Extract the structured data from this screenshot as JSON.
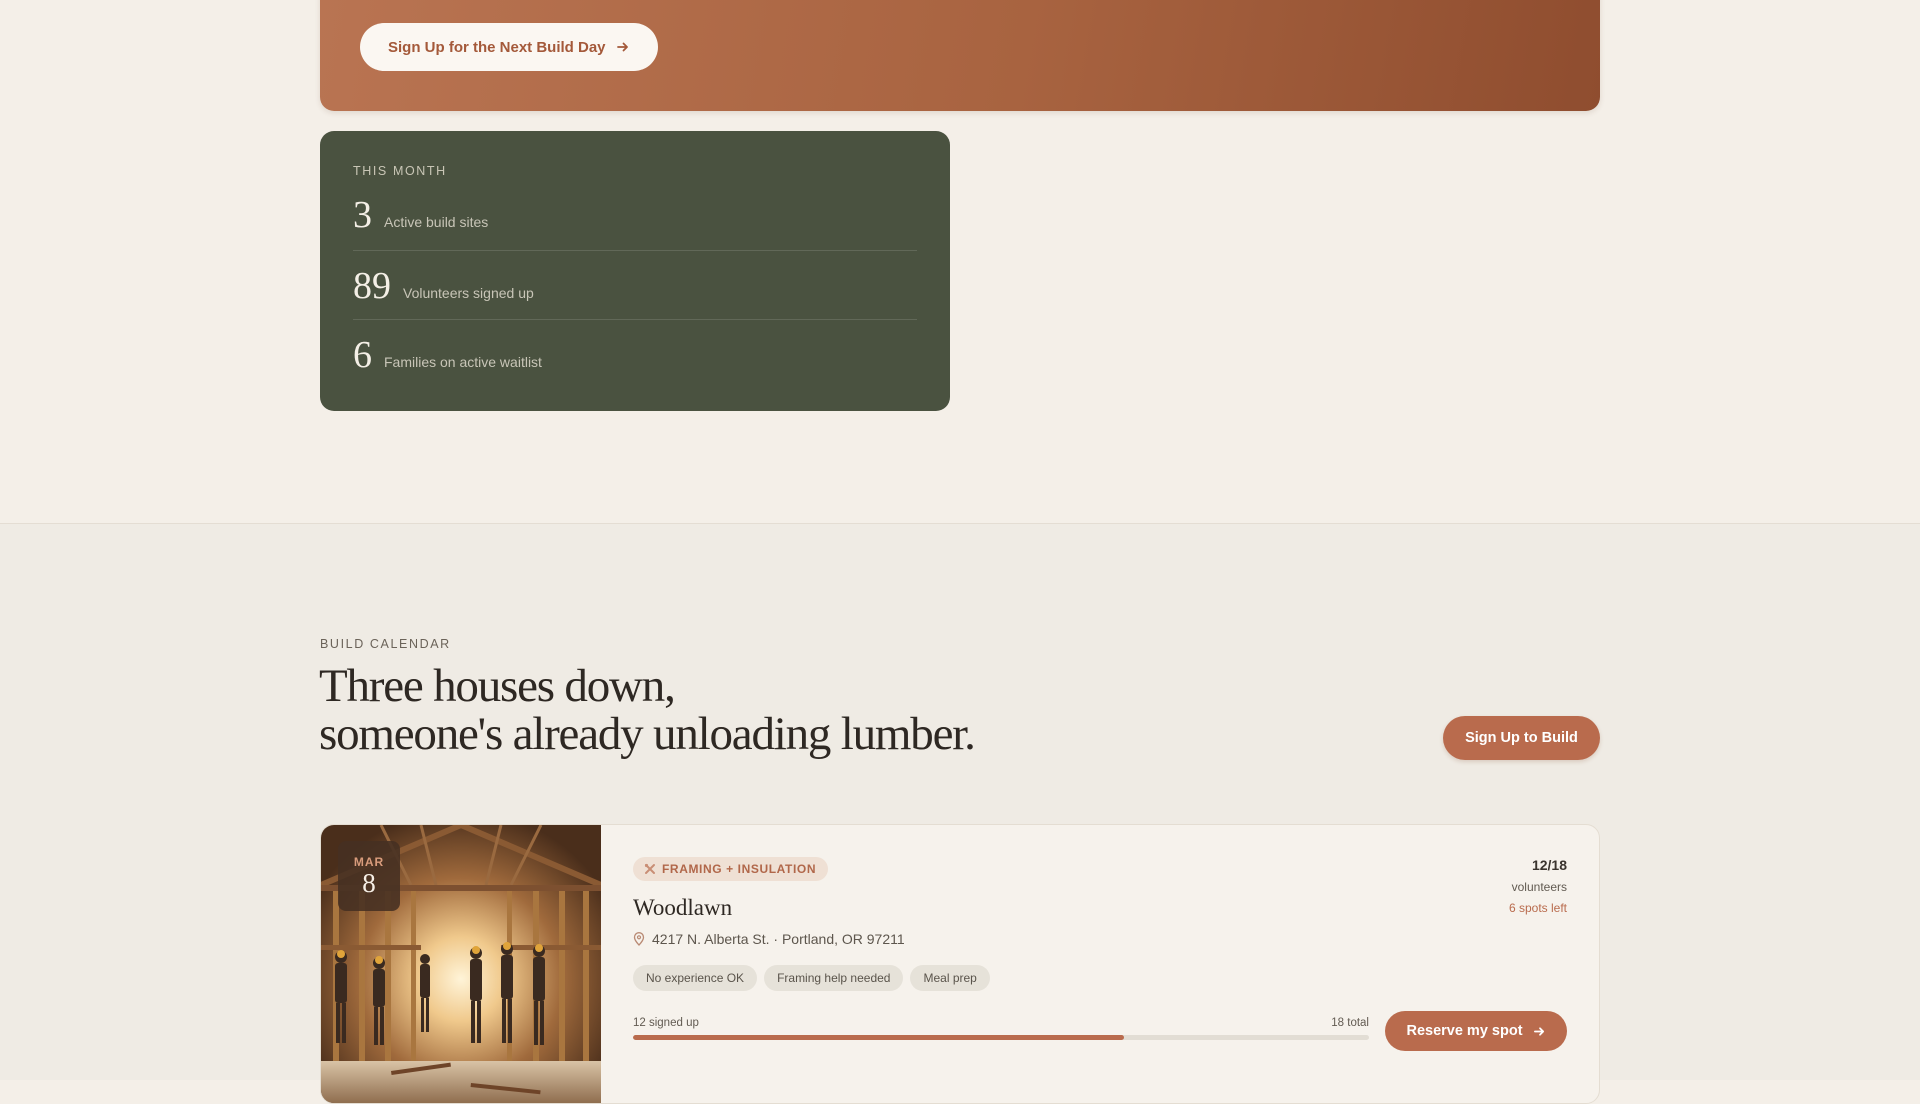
{
  "hero": {
    "cta_label": "Sign Up for the Next Build Day"
  },
  "stats": {
    "eyebrow": "THIS MONTH",
    "items": [
      {
        "value": "3",
        "label": "Active build sites"
      },
      {
        "value": "89",
        "label": "Volunteers signed up"
      },
      {
        "value": "6",
        "label": "Families on active waitlist"
      }
    ]
  },
  "calendar": {
    "eyebrow": "BUILD CALENDAR",
    "title_line1": "Three houses down,",
    "title_line2": "someone's already unloading lumber.",
    "signup_label": "Sign Up to Build"
  },
  "build": {
    "date_month": "MAR",
    "date_day": "8",
    "tag": "FRAMING + INSULATION",
    "name": "Woodlawn",
    "address": "4217 N. Alberta St. · Portland, OR 97211",
    "chips": [
      "No experience OK",
      "Framing help needed",
      "Meal prep"
    ],
    "capacity": "12/18",
    "capacity_label": "volunteers",
    "spots_left": "6 spots left",
    "signed_up_label": "12 signed up",
    "total_label": "18 total",
    "progress": 0.667,
    "reserve_label": "Reserve my spot"
  },
  "icons": {
    "arrow": "arrow-right-icon",
    "pin": "map-pin-icon",
    "tools": "tools-icon"
  },
  "colors": {
    "accent": "#b96b4d",
    "stats_bg": "#4a5240",
    "page_bg": "#f4efe8"
  }
}
